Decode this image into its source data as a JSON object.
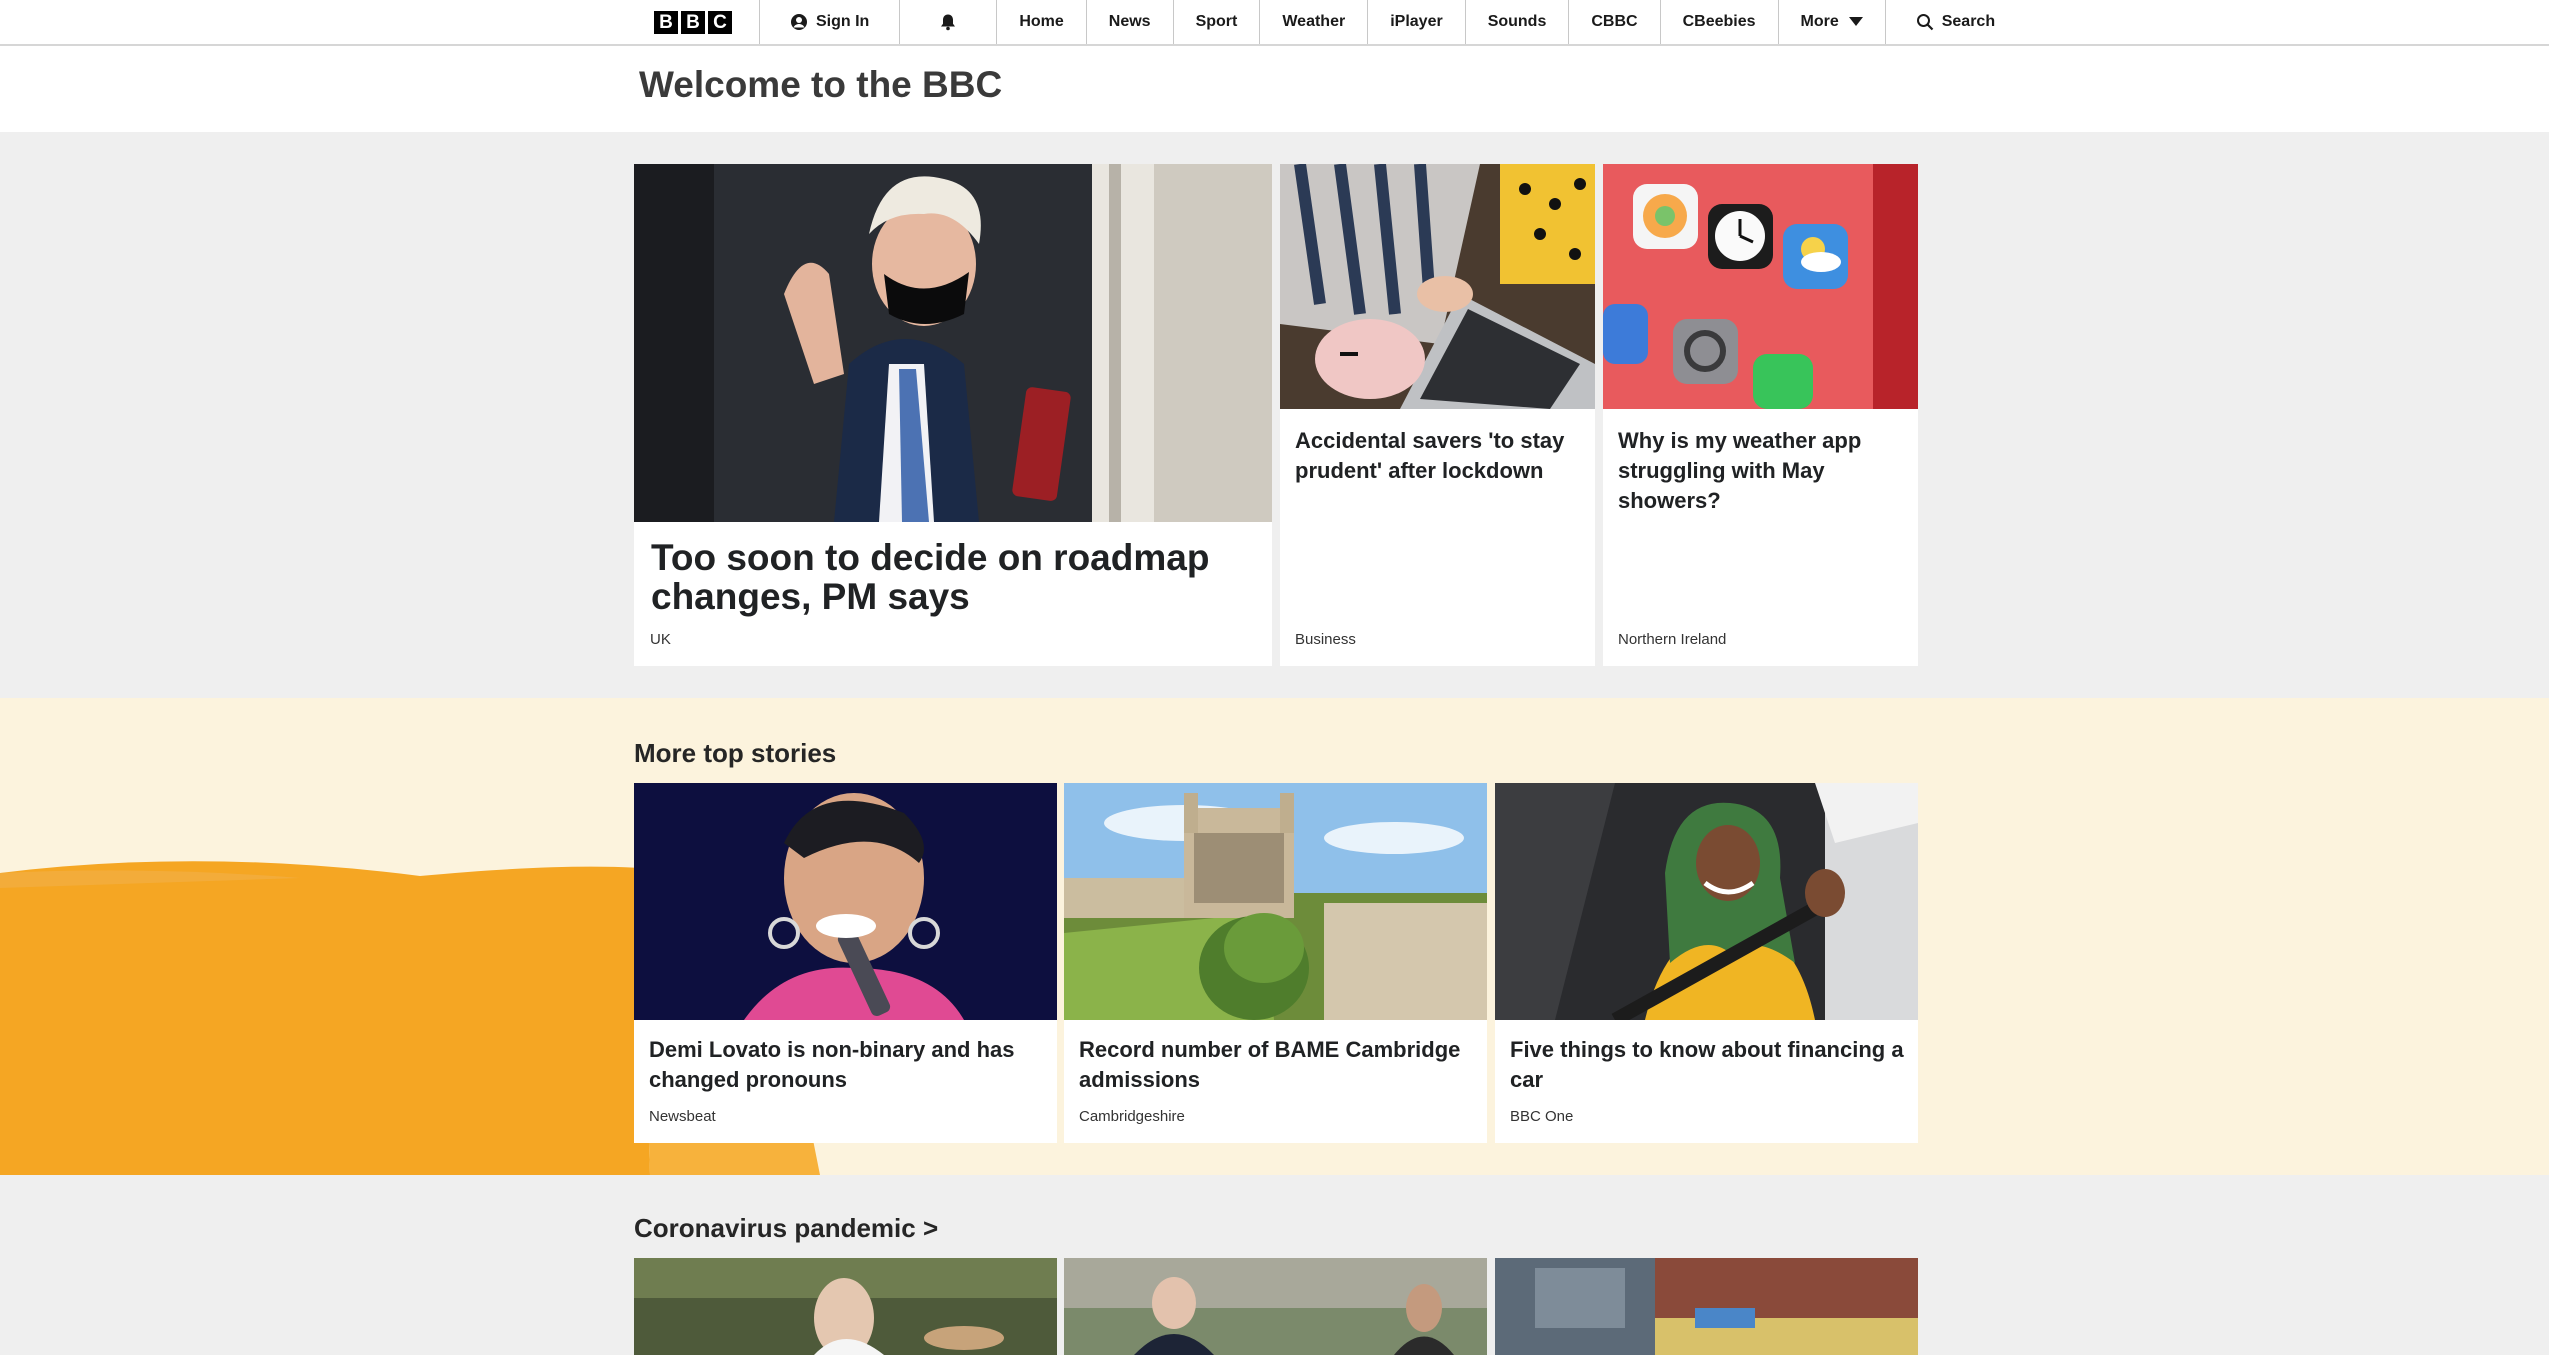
{
  "nav": {
    "logo_letters": [
      "B",
      "B",
      "C"
    ],
    "sign_in": "Sign In",
    "items": [
      "Home",
      "News",
      "Sport",
      "Weather",
      "iPlayer",
      "Sounds",
      "CBBC",
      "CBeebies"
    ],
    "more": "More",
    "search": "Search"
  },
  "welcome": {
    "title": "Welcome to the BBC"
  },
  "top": {
    "main": {
      "headline": "Too soon to decide on roadmap changes, PM says",
      "tag": "UK"
    },
    "business": {
      "headline": "Accidental savers 'to stay prudent' after lockdown",
      "tag": "Business"
    },
    "ni": {
      "headline": "Why is my weather app struggling with May showers?",
      "tag": "Northern Ireland"
    }
  },
  "more_top": {
    "title": "More top stories",
    "items": [
      {
        "headline": "Demi Lovato is non-binary and has changed pronouns",
        "tag": "Newsbeat"
      },
      {
        "headline": "Record number of BAME Cambridge admissions",
        "tag": "Cambridgeshire"
      },
      {
        "headline": "Five things to know about financing a car",
        "tag": "BBC One"
      }
    ]
  },
  "coronavirus": {
    "title": "Coronavirus pandemic >"
  },
  "colors": {
    "band_cream": "#fcf3dd",
    "band_orange": "#f5a623",
    "page_bg": "#efefef"
  }
}
